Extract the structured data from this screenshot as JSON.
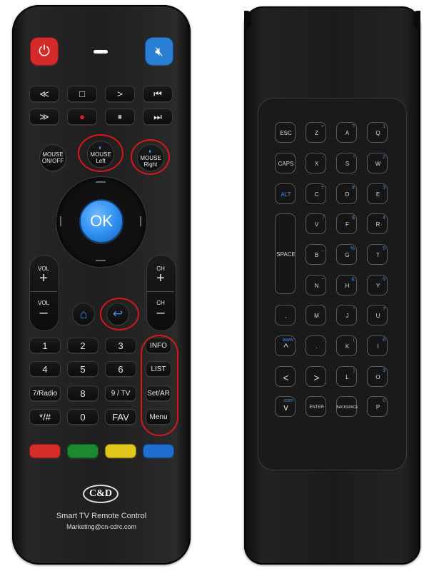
{
  "front": {
    "media_row1": [
      "≪",
      "□",
      ">",
      "⏮"
    ],
    "media_row2": [
      "≫",
      "●",
      "⏸",
      "⏭"
    ],
    "mouse_onoff": "MOUSE ON/OFF",
    "mouse_left": "MOUSE Left",
    "mouse_right": "MOUSE Right",
    "ok": "OK",
    "vol": "VOL",
    "ch": "CH",
    "plus": "+",
    "minus": "–",
    "numpad": [
      {
        "label": "1"
      },
      {
        "label": "2"
      },
      {
        "label": "3"
      },
      {
        "label": "INFO"
      },
      {
        "label": "4"
      },
      {
        "label": "5"
      },
      {
        "label": "6"
      },
      {
        "label": "LIST"
      },
      {
        "label": "7/Radio"
      },
      {
        "label": "8"
      },
      {
        "label": "9 / TV"
      },
      {
        "label": "Set/AR"
      },
      {
        "label": "*/#"
      },
      {
        "label": "0"
      },
      {
        "label": "FAV"
      },
      {
        "label": "Menu"
      }
    ],
    "color_keys": [
      "#d62d2b",
      "#1b8a2e",
      "#e3c81c",
      "#1f6fd1"
    ],
    "logo": "C&D",
    "product": "Smart TV Remote Control",
    "email": "Marketing@cn-cdrc.com",
    "power_color": "#d42a2a",
    "mute_color": "#2a7fd4",
    "ok_color": "#2d8ef0"
  },
  "back": {
    "esc": "ESC",
    "caps": "CAPS",
    "alt": "ALT",
    "space": "SPACE",
    "enter": "ENTER",
    "backspace": "BACKSPACE",
    "www": "www",
    "com": ".com",
    "keys": [
      [
        "Q",
        "1"
      ],
      [
        "W",
        "2"
      ],
      [
        "E",
        "3"
      ],
      [
        "R",
        "4"
      ],
      [
        "T",
        "5"
      ],
      [
        "Y",
        "6"
      ],
      [
        "U",
        "7"
      ],
      [
        "I",
        "8"
      ],
      [
        "O",
        "9"
      ],
      [
        "P",
        "0"
      ],
      [
        "A",
        "?"
      ],
      [
        "S",
        "!"
      ],
      [
        "D",
        "#"
      ],
      [
        "F",
        "$"
      ],
      [
        "G",
        "%"
      ],
      [
        "H",
        "&"
      ],
      [
        "J",
        "*"
      ],
      [
        "K",
        "("
      ],
      [
        "L",
        ")"
      ],
      [
        "Z",
        "+"
      ],
      [
        "X",
        "-"
      ],
      [
        "C",
        "="
      ],
      [
        "V",
        "/"
      ],
      [
        "B",
        "_"
      ],
      [
        "N",
        "~"
      ],
      [
        "M",
        "'"
      ],
      [
        ",",
        ""
      ],
      [
        ".",
        ":"
      ]
    ]
  }
}
